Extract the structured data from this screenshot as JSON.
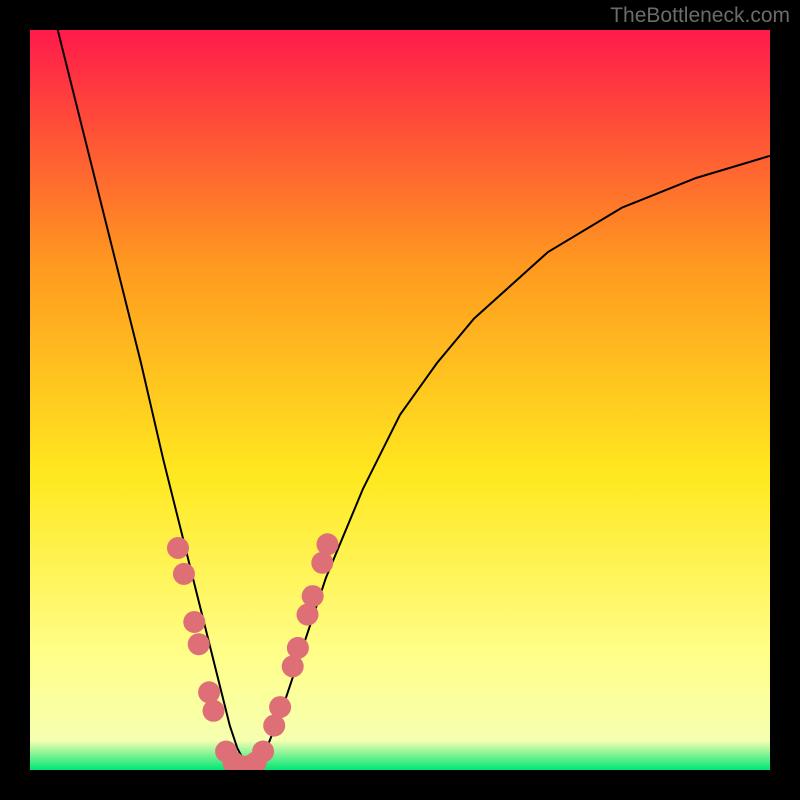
{
  "watermark": "TheBottleneck.com",
  "chart_data": {
    "type": "line",
    "title": "",
    "xlabel": "",
    "ylabel": "",
    "xlim": [
      0,
      100
    ],
    "ylim": [
      0,
      100
    ],
    "gradient_colors": {
      "top": "#ff1a4a",
      "upper_mid": "#ff9a1f",
      "mid": "#ffe81f",
      "lower_mid": "#ffff8c",
      "bottom": "#00e676"
    },
    "series": [
      {
        "name": "bottleneck-curve",
        "x": [
          0,
          5,
          10,
          15,
          18,
          20,
          22,
          24,
          26,
          27,
          28,
          29,
          30,
          32,
          34,
          36,
          38,
          40,
          45,
          50,
          55,
          60,
          70,
          80,
          90,
          100
        ],
        "y": [
          115,
          95,
          75,
          55,
          42,
          34,
          26,
          18,
          10,
          6,
          3,
          1,
          1,
          3,
          8,
          14,
          20,
          26,
          38,
          48,
          55,
          61,
          70,
          76,
          80,
          83
        ]
      }
    ],
    "highlight_dots": {
      "name": "highlighted-points",
      "points": [
        {
          "x": 20.0,
          "y": 30
        },
        {
          "x": 20.8,
          "y": 26.5
        },
        {
          "x": 22.2,
          "y": 20
        },
        {
          "x": 22.8,
          "y": 17
        },
        {
          "x": 24.2,
          "y": 10.5
        },
        {
          "x": 24.8,
          "y": 8
        },
        {
          "x": 26.5,
          "y": 2.5
        },
        {
          "x": 27.5,
          "y": 1
        },
        {
          "x": 28.5,
          "y": 0.5
        },
        {
          "x": 29.5,
          "y": 0.5
        },
        {
          "x": 30.5,
          "y": 1
        },
        {
          "x": 31.5,
          "y": 2.5
        },
        {
          "x": 33.0,
          "y": 6
        },
        {
          "x": 33.8,
          "y": 8.5
        },
        {
          "x": 35.5,
          "y": 14
        },
        {
          "x": 36.2,
          "y": 16.5
        },
        {
          "x": 37.5,
          "y": 21
        },
        {
          "x": 38.2,
          "y": 23.5
        },
        {
          "x": 39.5,
          "y": 28
        },
        {
          "x": 40.2,
          "y": 30.5
        }
      ]
    }
  }
}
